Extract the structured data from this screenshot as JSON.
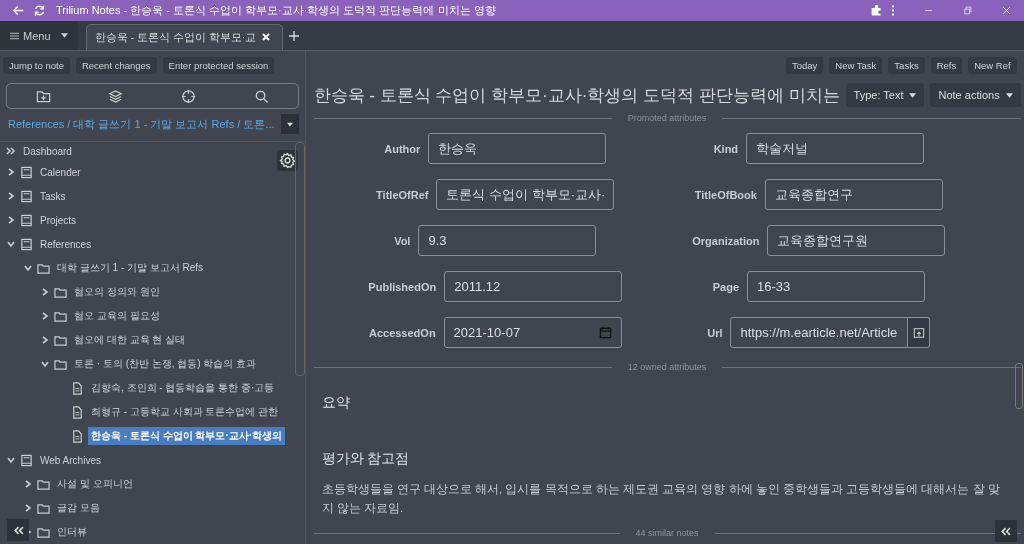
{
  "window": {
    "title": "Trilium Notes - 한승욱 - 토론식 수업이 학부모·교사·학생의 도덕적 판단능력에 미치는 영향"
  },
  "menu": {
    "label": "Menu"
  },
  "tabs": [
    {
      "label": "한승욱 - 토론식 수업이 학부모·교",
      "selected": true
    }
  ],
  "left_buttons": [
    "Jump to note",
    "Recent changes",
    "Enter protected session"
  ],
  "right_buttons": [
    "Today",
    "New Task",
    "Tasks",
    "Refs",
    "New Ref"
  ],
  "breadcrumb": "References / 대학 글쓰기 1 - 기말 보고서 Refs / 토론...",
  "tree": [
    {
      "label": "Dashboard",
      "kind": "launcher",
      "selected": false
    },
    {
      "label": "Calender",
      "kind": "book",
      "expanded": false,
      "selected": false
    },
    {
      "label": "Tasks",
      "kind": "book",
      "expanded": false,
      "selected": false
    },
    {
      "label": "Projects",
      "kind": "book",
      "expanded": false,
      "selected": false
    },
    {
      "label": "References",
      "kind": "book",
      "expanded": true,
      "selected": false,
      "children": [
        {
          "label": "대학 글쓰기 1 - 기말 보고서 Refs",
          "kind": "folder",
          "expanded": true,
          "selected": false,
          "children": [
            {
              "label": "혐오의 정의와 원인",
              "kind": "folder",
              "expanded": false,
              "selected": false
            },
            {
              "label": "혐오 교육의 필요성",
              "kind": "folder",
              "expanded": false,
              "selected": false
            },
            {
              "label": "혐오에 대한 교육 현 실태",
              "kind": "folder",
              "expanded": false,
              "selected": false
            },
            {
              "label": "토론 · 토의 (찬반 논쟁, 협동) 학습의 효과",
              "kind": "folder",
              "expanded": true,
              "selected": false,
              "children": [
                {
                  "label": "김향숙, 조인희 - 협동학습을 통한 중·고등",
                  "kind": "note",
                  "selected": false
                },
                {
                  "label": "최형규 - 고등학교 사회과 토론수업에 관한",
                  "kind": "note",
                  "selected": false
                },
                {
                  "label": "한승욱 - 토론식 수업이 학부모·교사·학생의",
                  "kind": "note",
                  "selected": true
                }
              ]
            }
          ]
        }
      ]
    },
    {
      "label": "Web Archives",
      "kind": "book",
      "expanded": true,
      "selected": false,
      "children": [
        {
          "label": "사설 및 오피니언",
          "kind": "folder",
          "expanded": false,
          "selected": false
        },
        {
          "label": "글감 모음",
          "kind": "folder",
          "expanded": false,
          "selected": false
        },
        {
          "label": "인터뷰",
          "kind": "folder",
          "expanded": false,
          "selected": false
        }
      ]
    }
  ],
  "note": {
    "title": "한승욱 - 토론식 수업이 학부모·교사·학생의 도덕적 판단능력에 미치는",
    "type_button": "Type: Text",
    "actions_button": "Note actions"
  },
  "promoted_label": "Promoted attributes",
  "attributes": [
    {
      "label": "Author",
      "value": "한승욱",
      "kind": "text"
    },
    {
      "label": "Kind",
      "value": "학술저널",
      "kind": "text"
    },
    {
      "label": "TitleOfRef",
      "value": "토론식 수업이 학부모·교사·",
      "kind": "text"
    },
    {
      "label": "TitleOfBook",
      "value": "교육종합연구",
      "kind": "text"
    },
    {
      "label": "Vol",
      "value": "9.3",
      "kind": "text"
    },
    {
      "label": "Organization",
      "value": "교육종합연구원",
      "kind": "text"
    },
    {
      "label": "PublishedOn",
      "value": "2011.12",
      "kind": "text"
    },
    {
      "label": "Page",
      "value": "16-33",
      "kind": "text"
    },
    {
      "label": "AccessedOn",
      "value": "2021-10-07",
      "kind": "date"
    },
    {
      "label": "Url",
      "value": "https://m.earticle.net/Article",
      "kind": "url"
    }
  ],
  "owned_label": "12 owned attributes",
  "content": [
    {
      "kind": "heading",
      "text": "요약"
    },
    {
      "kind": "heading",
      "text": "평가와 참고점"
    },
    {
      "kind": "paragraph",
      "text": " 초등학생들을 연구 대상으로 해서, 입시를 목적으로 하는 제도권 교육의 영향 하에 놓인 중학생들과 고등학생들에 대해서는 잘 맞지 않는 자료임."
    }
  ],
  "similar_label": "44 similar notes"
}
